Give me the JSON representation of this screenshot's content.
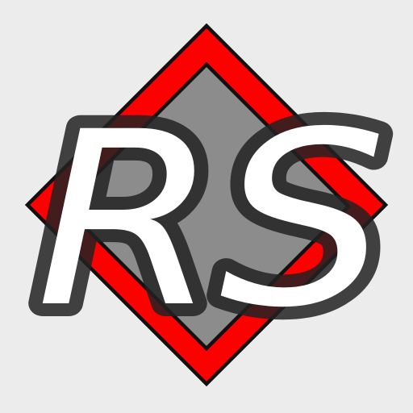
{
  "logo": {
    "text": "RS",
    "icon": "diamond-rs-logo-icon",
    "colors": {
      "background": "#ececec",
      "diamond_fill": "#ff0000",
      "diamond_outline": "#111111",
      "inner_diamond_fill": "#8c8c8c",
      "letter_fill": "#ffffff",
      "letter_outline": "#222222"
    }
  }
}
